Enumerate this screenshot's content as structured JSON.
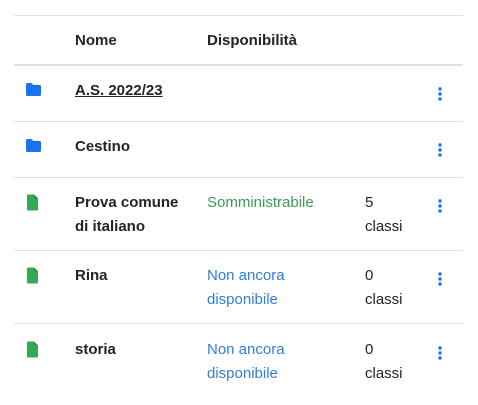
{
  "header": {
    "name": "Nome",
    "availability": "Disponibilità"
  },
  "rows": [
    {
      "icon": "folder-icon",
      "name": "A.S. 2022/23",
      "status": "",
      "count_num": "",
      "count_unit": ""
    },
    {
      "icon": "folder-icon",
      "name": "Cestino",
      "status": "",
      "count_num": "",
      "count_unit": ""
    },
    {
      "icon": "file-icon",
      "name_l1": "Prova comune",
      "name_l2": "di italiano",
      "status": "Somministrabile",
      "count_num": "5",
      "count_unit": "classi"
    },
    {
      "icon": "file-icon",
      "name": "Rina",
      "status_l1": "Non ancora",
      "status_l2": "disponibile",
      "count_num": "0",
      "count_unit": "classi"
    },
    {
      "icon": "file-icon",
      "name": "storia",
      "status_l1": "Non ancora",
      "status_l2": "disponibile",
      "count_num": "0",
      "count_unit": "classi"
    }
  ],
  "colors": {
    "folder": "#1a73e8",
    "file": "#34a853",
    "kebab": "#1a73e8",
    "status_ok": "#3d9b57",
    "status_na": "#2f7fdb"
  }
}
